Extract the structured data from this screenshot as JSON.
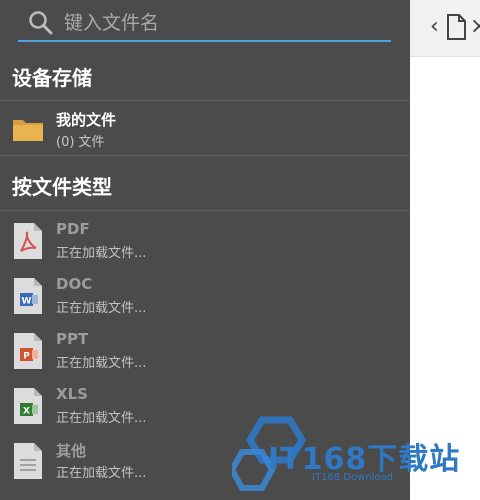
{
  "search": {
    "placeholder": "键入文件名"
  },
  "sections": {
    "device_storage": "设备存储",
    "by_type": "按文件类型"
  },
  "my_files": {
    "label": "我的文件",
    "count": "(0) 文件"
  },
  "file_types": [
    {
      "label": "PDF",
      "status": "正在加载文件...",
      "icon": "pdf-icon"
    },
    {
      "label": "DOC",
      "status": "正在加载文件...",
      "icon": "doc-icon"
    },
    {
      "label": "PPT",
      "status": "正在加载文件...",
      "icon": "ppt-icon"
    },
    {
      "label": "XLS",
      "status": "正在加载文件...",
      "icon": "xls-icon"
    },
    {
      "label": "其他",
      "status": "正在加载文件...",
      "icon": "other-file-icon"
    }
  ],
  "watermark": {
    "text": "IT168下载站",
    "subtext": "IT168 Download"
  },
  "colors": {
    "drawer_bg": "#4b4b4b",
    "search_underline": "#4aa3df",
    "folder": "#e7b450",
    "pdf": "#d9534f",
    "doc": "#3b6ab8",
    "ppt": "#d2532f",
    "xls": "#2e7d32"
  }
}
